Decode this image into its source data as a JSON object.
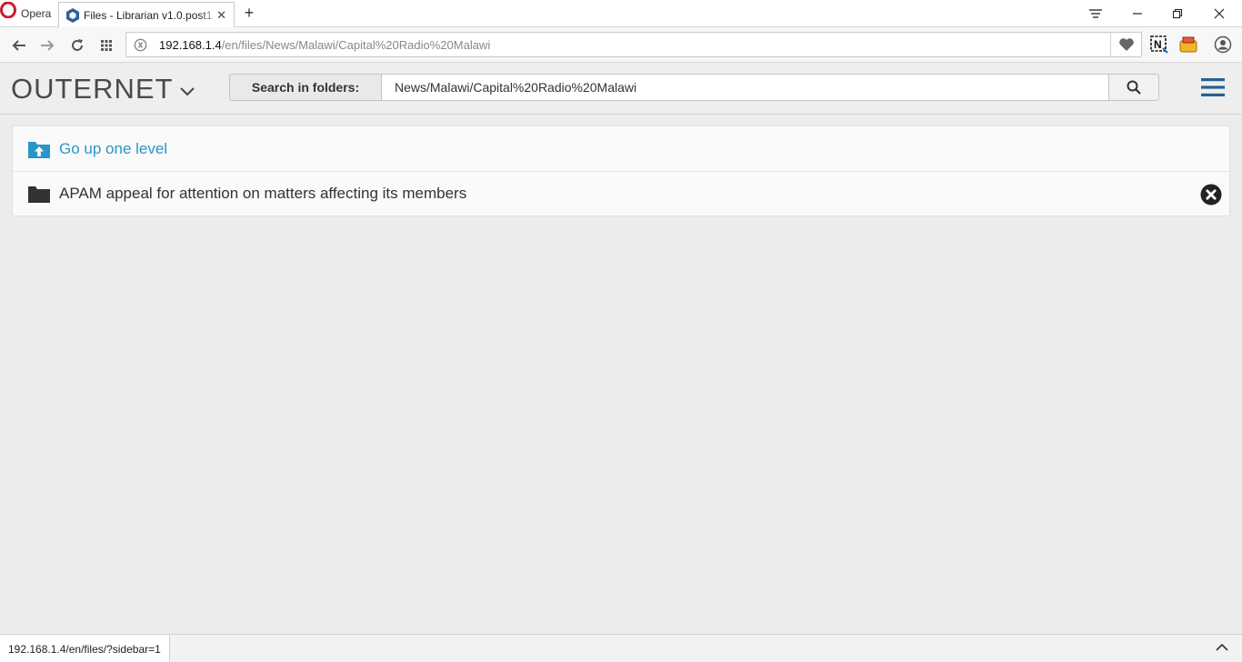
{
  "browser": {
    "opera_label": "Opera",
    "tab_title": "Files - Librarian v1.0.post1",
    "url_host": "192.168.1.4",
    "url_path": "/en/files/News/Malawi/Capital%20Radio%20Malawi",
    "status_url": "192.168.1.4/en/files/?sidebar=1"
  },
  "app": {
    "brand": "OUTERNET",
    "search_label": "Search in folders:",
    "search_value": "News/Malawi/Capital%20Radio%20Malawi"
  },
  "list": {
    "up_label": "Go up one level",
    "items": [
      {
        "label": "APAM appeal for attention on matters affecting its members"
      }
    ]
  },
  "colors": {
    "link": "#2a95c8",
    "menu": "#2a5f93",
    "folder": "#333333"
  }
}
